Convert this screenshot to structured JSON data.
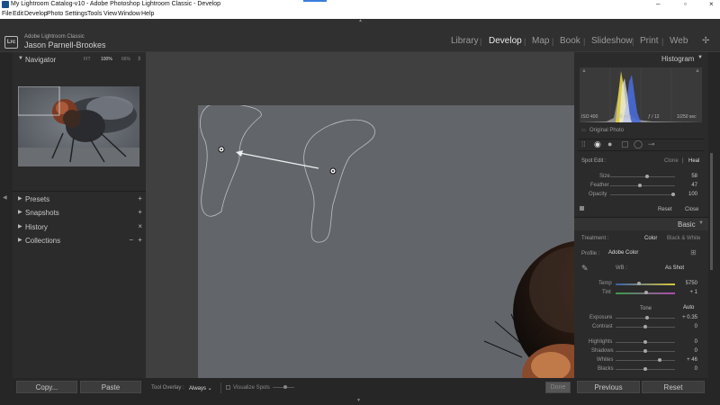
{
  "window": {
    "title": "My Lightroom Catalog-v10 - Adobe Photoshop Lightroom Classic - Develop",
    "controls": [
      "–",
      "▫",
      "×"
    ]
  },
  "menu": [
    "File",
    "Edit",
    "Develop",
    "Photo",
    "Settings",
    "Tools",
    "View",
    "Window",
    "Help"
  ],
  "identity": {
    "logo": "Lrc",
    "app_name": "Adobe Lightroom Classic",
    "user_name": "Jason Parnell-Brookes"
  },
  "modules": [
    "Library",
    "Develop",
    "Map",
    "Book",
    "Slideshow",
    "Print",
    "Web"
  ],
  "active_module": "Develop",
  "navigator": {
    "title": "Navigator",
    "zoom_options": [
      "FIT",
      "100%",
      "66%"
    ],
    "zoom_more": "⇕"
  },
  "left_panels": [
    {
      "label": "Presets",
      "action": "+"
    },
    {
      "label": "Snapshots",
      "action": "+"
    },
    {
      "label": "History",
      "action": "×"
    },
    {
      "label": "Collections",
      "action": "+",
      "secondary": "−"
    }
  ],
  "histogram": {
    "title": "Histogram",
    "iso": "ISO 400",
    "focal": "50 mm",
    "aperture": "ƒ / 12",
    "shutter": "1/250 sec",
    "original_label": "Original Photo"
  },
  "spot_edit": {
    "title": "Spot Edit :",
    "modes": [
      "Clone",
      "Heal"
    ],
    "active_mode": "Heal",
    "sliders": [
      {
        "label": "Size",
        "value": "58",
        "pos": 0.58
      },
      {
        "label": "Feather",
        "value": "47",
        "pos": 0.47
      },
      {
        "label": "Opacity",
        "value": "100",
        "pos": 1.0
      }
    ],
    "reset": "Reset",
    "close": "Close"
  },
  "basic": {
    "title": "Basic",
    "treatment_label": "Treatment :",
    "treatment_options": [
      "Color",
      "Black & White"
    ],
    "profile_label": "Profile :",
    "profile_value": "Adobe Color",
    "wb_label": "WB :",
    "wb_value": "As Shot",
    "temp": {
      "label": "Temp",
      "value": "5750",
      "pos": 0.5
    },
    "tint": {
      "label": "Tint",
      "value": "+ 1",
      "pos": 0.52
    },
    "tone_label": "Tone",
    "auto_label": "Auto",
    "tone_sliders": [
      {
        "label": "Exposure",
        "value": "+ 0.35",
        "pos": 0.53
      },
      {
        "label": "Contrast",
        "value": "0",
        "pos": 0.5
      },
      {
        "label": "Highlights",
        "value": "0",
        "pos": 0.5
      },
      {
        "label": "Shadows",
        "value": "0",
        "pos": 0.5
      },
      {
        "label": "Whites",
        "value": "+ 46",
        "pos": 0.73
      },
      {
        "label": "Blacks",
        "value": "0",
        "pos": 0.5
      }
    ]
  },
  "toolbar": {
    "overlay_label": "Tool Overlay :",
    "overlay_value": "Always ⌄",
    "visualize_label": "Visualize Spots",
    "done_label": "Done"
  },
  "buttons": {
    "copy": "Copy...",
    "paste": "Paste",
    "previous": "Previous",
    "reset": "Reset"
  }
}
